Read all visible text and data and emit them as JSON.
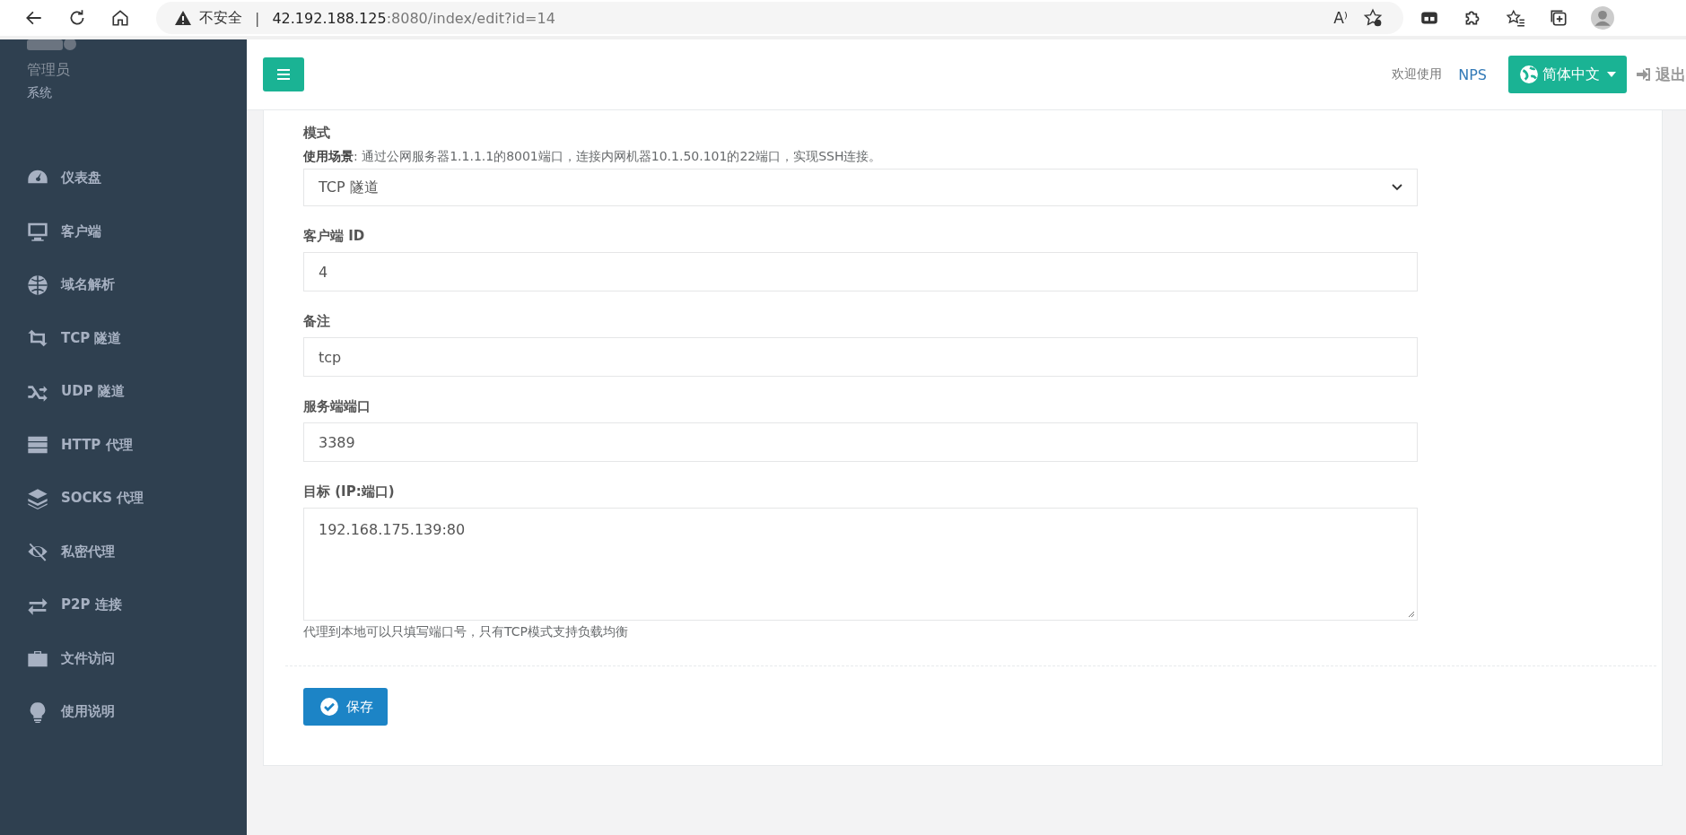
{
  "browser": {
    "security": "不安全",
    "separator": "|",
    "url": "**42.192.188.125**:8080/index/edit?id=14",
    "read_aloud": "A⁾"
  },
  "sidebar": {
    "user": "管理员",
    "role": "系统",
    "items": [
      {
        "label": "仪表盘"
      },
      {
        "label": "客户端"
      },
      {
        "label": "域名解析"
      },
      {
        "label": "TCP 隧道"
      },
      {
        "label": "UDP 隧道"
      },
      {
        "label": "HTTP 代理"
      },
      {
        "label": "SOCKS 代理"
      },
      {
        "label": "私密代理"
      },
      {
        "label": "P2P 连接"
      },
      {
        "label": "文件访问"
      },
      {
        "label": "使用说明"
      }
    ]
  },
  "header": {
    "welcome": "欢迎使用",
    "brand": "NPS",
    "language": "简体中文",
    "logout": "退出"
  },
  "form": {
    "mode": {
      "label": "模式",
      "usage": "**使用场景**: 通过公网服务器1.1.1.1的8001端口，连接内网机器10.1.50.101的22端口，实现SSH连接。",
      "value": "TCP 隧道"
    },
    "fields": [
      {
        "kind": "input",
        "label": "客户端 ID",
        "value": "4"
      },
      {
        "kind": "input",
        "label": "备注",
        "value": "tcp"
      },
      {
        "kind": "input",
        "label": "服务端端口",
        "value": "3389"
      },
      {
        "kind": "textarea",
        "label": "目标 (IP:端口)",
        "value": "192.168.175.139:80",
        "hint": "代理到本地可以只填写端口号，只有TCP模式支持负载均衡"
      }
    ],
    "save": "保存"
  }
}
